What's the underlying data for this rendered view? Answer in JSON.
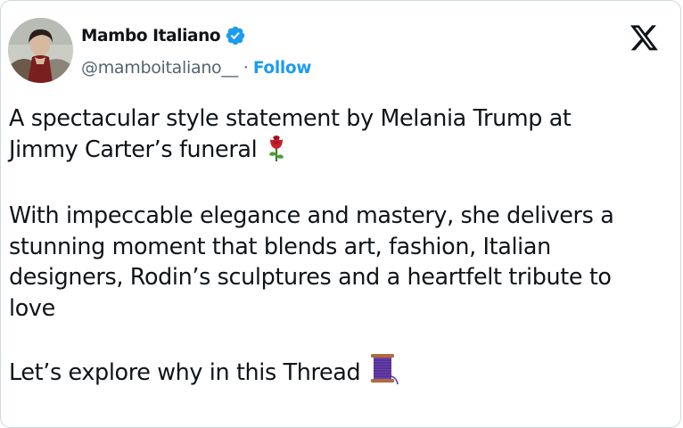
{
  "tweet": {
    "author": {
      "display_name": "Mambo Italiano",
      "handle": "@mamboitaliano__",
      "verified": true,
      "follow_label": "Follow",
      "separator": "·"
    },
    "platform_icon": "x-logo-icon",
    "paragraphs": [
      {
        "lines": [
          "A spectacular style statement by Melania Trump at",
          "Jimmy Carter’s funeral"
        ],
        "emoji": "rose-icon"
      },
      {
        "lines": [
          "With impeccable elegance and mastery, she delivers a",
          "stunning moment that blends art, fashion, Italian",
          "designers, Rodin’s sculptures and a heartfelt tribute to",
          "love"
        ]
      },
      {
        "lines": [
          "Let’s explore why in this Thread"
        ],
        "emoji": "thread-spool-icon"
      }
    ]
  },
  "colors": {
    "text": "#0f1419",
    "secondary": "#536471",
    "accent": "#1d9bf0",
    "border": "#cfd9de"
  }
}
